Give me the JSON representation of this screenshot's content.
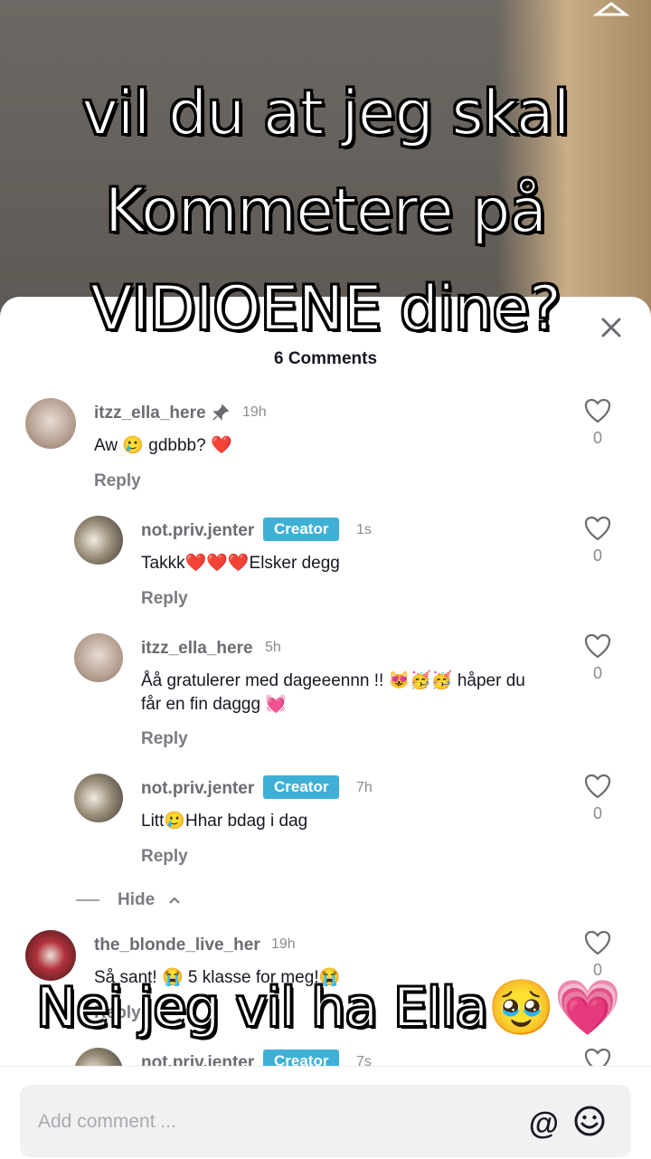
{
  "overlay": {
    "top_caption_lines": [
      "vil du at jeg skal",
      "Kommetere på",
      "VIDIOENE dine?"
    ],
    "bottom_caption_text": "Nei jeg vil ha Ella",
    "bottom_caption_emoji": "🥹💗"
  },
  "sheet": {
    "title": "6 Comments",
    "close_icon": "close-icon"
  },
  "comments": [
    {
      "username": "itzz_ella_here",
      "pinned": true,
      "time": "19h",
      "text": "Aw 🥲 gdbbb? ❤️",
      "reply": "Reply",
      "likes": "0"
    },
    {
      "username": "not.priv.jenter",
      "creator": "Creator",
      "time": "1s",
      "text": "Takkk❤️❤️❤️Elsker degg",
      "reply": "Reply",
      "likes": "0"
    },
    {
      "username": "itzz_ella_here",
      "time": "5h",
      "text_line1": "Åå gratulerer med dageeennn !! 😻🥳🥳 håper du",
      "text_line2": "får en fin daggg 💓",
      "reply": "Reply",
      "likes": "0"
    },
    {
      "username": "not.priv.jenter",
      "creator": "Creator",
      "time": "7h",
      "text": "Litt🥲Hhar bdag i dag",
      "reply": "Reply",
      "likes": "0"
    },
    {
      "username": "the_blonde_live_her",
      "time": "19h",
      "text": "Så sant! 😭 5 klasse for meg!😭",
      "reply": "Reply",
      "likes": "0"
    },
    {
      "username": "not.priv.jenter",
      "creator": "Creator",
      "time": "7s"
    }
  ],
  "hide_label": "Hide",
  "bottom_bar": {
    "placeholder": "Add comment ...",
    "at_symbol": "@"
  }
}
